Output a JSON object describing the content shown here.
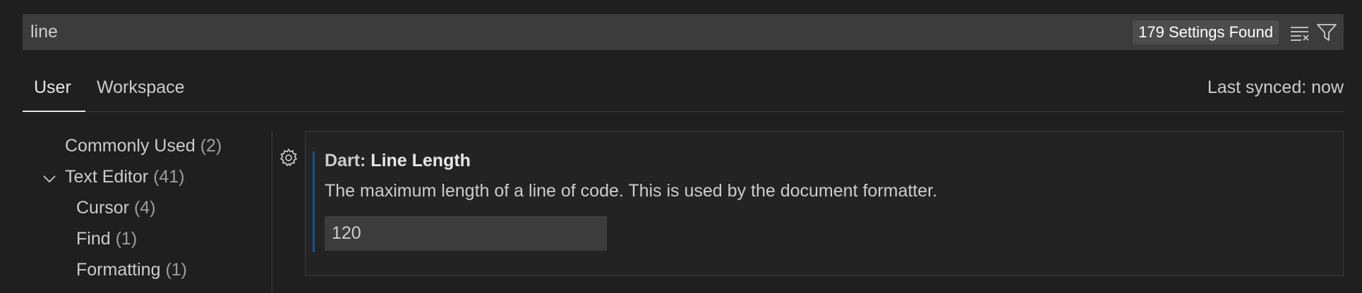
{
  "search": {
    "value": "line",
    "result_count": "179 Settings Found",
    "clear_icon": "clear-filter-icon",
    "filter_icon": "filter-icon"
  },
  "tabs": [
    {
      "label": "User",
      "active": true
    },
    {
      "label": "Workspace",
      "active": false
    }
  ],
  "sync_status": "Last synced: now",
  "toc": [
    {
      "label": "Commonly Used",
      "count": "(2)"
    },
    {
      "label": "Text Editor",
      "count": "(41)",
      "expanded": true
    },
    {
      "label": "Cursor",
      "count": "(4)"
    },
    {
      "label": "Find",
      "count": "(1)"
    },
    {
      "label": "Formatting",
      "count": "(1)"
    }
  ],
  "setting": {
    "category": "Dart: ",
    "name": "Line Length",
    "description": "The maximum length of a line of code. This is used by the document formatter.",
    "value": "120",
    "gear_icon": "gear-icon"
  },
  "colors": {
    "background": "#1f1f1f",
    "input_background": "#3c3c3c",
    "modified_indicator": "#0078d4"
  }
}
